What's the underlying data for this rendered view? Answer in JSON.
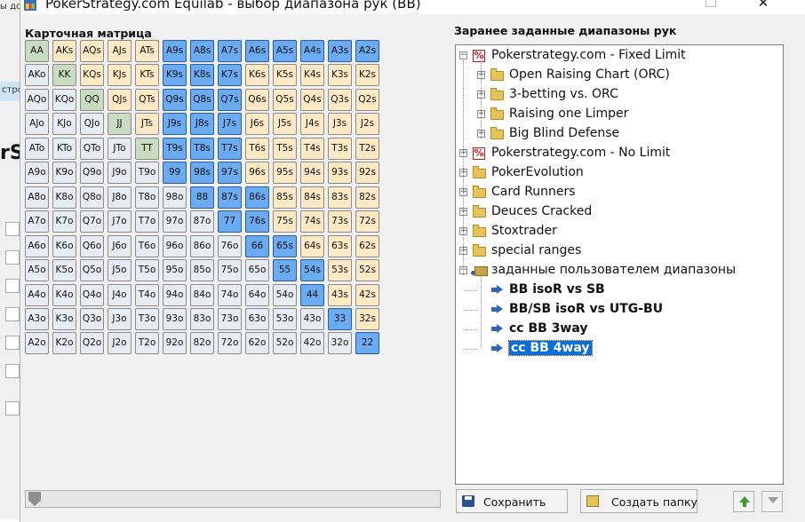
{
  "window": {
    "title": "PokerStrategy.com Equilab - выбор диапазона рук (BB)"
  },
  "background_app": {
    "label_top": "ы до",
    "label_mid": "стро",
    "label_big": "rS"
  },
  "matrix": {
    "label": "Карточная матрица",
    "rows": [
      [
        "AA",
        "AKs",
        "AQs",
        "AJs",
        "ATs",
        "A9s",
        "A8s",
        "A7s",
        "A6s",
        "A5s",
        "A4s",
        "A3s",
        "A2s"
      ],
      [
        "AKo",
        "KK",
        "KQs",
        "KJs",
        "KTs",
        "K9s",
        "K8s",
        "K7s",
        "K6s",
        "K5s",
        "K4s",
        "K3s",
        "K2s"
      ],
      [
        "AQo",
        "KQo",
        "QQ",
        "QJs",
        "QTs",
        "Q9s",
        "Q8s",
        "Q7s",
        "Q6s",
        "Q5s",
        "Q4s",
        "Q3s",
        "Q2s"
      ],
      [
        "AJo",
        "KJo",
        "QJo",
        "JJ",
        "JTs",
        "J9s",
        "J8s",
        "J7s",
        "J6s",
        "J5s",
        "J4s",
        "J3s",
        "J2s"
      ],
      [
        "ATo",
        "KTo",
        "QTo",
        "JTo",
        "TT",
        "T9s",
        "T8s",
        "T7s",
        "T6s",
        "T5s",
        "T4s",
        "T3s",
        "T2s"
      ],
      [
        "A9o",
        "K9o",
        "Q9o",
        "J9o",
        "T9o",
        "99",
        "98s",
        "97s",
        "96s",
        "95s",
        "94s",
        "93s",
        "92s"
      ],
      [
        "A8o",
        "K8o",
        "Q8o",
        "J8o",
        "T8o",
        "98o",
        "88",
        "87s",
        "86s",
        "85s",
        "84s",
        "83s",
        "82s"
      ],
      [
        "A7o",
        "K7o",
        "Q7o",
        "J7o",
        "T7o",
        "97o",
        "87o",
        "77",
        "76s",
        "75s",
        "74s",
        "73s",
        "72s"
      ],
      [
        "A6o",
        "K6o",
        "Q6o",
        "J6o",
        "T6o",
        "96o",
        "86o",
        "76o",
        "66",
        "65s",
        "64s",
        "63s",
        "62s"
      ],
      [
        "A5o",
        "K5o",
        "Q5o",
        "J5o",
        "T5o",
        "95o",
        "85o",
        "75o",
        "65o",
        "55",
        "54s",
        "53s",
        "52s"
      ],
      [
        "A4o",
        "K4o",
        "Q4o",
        "J4o",
        "T4o",
        "94o",
        "84o",
        "74o",
        "64o",
        "54o",
        "44",
        "43s",
        "42s"
      ],
      [
        "A3o",
        "K3o",
        "Q3o",
        "J3o",
        "T3o",
        "93o",
        "83o",
        "73o",
        "63o",
        "53o",
        "43o",
        "33",
        "32s"
      ],
      [
        "A2o",
        "K2o",
        "Q2o",
        "J2o",
        "T2o",
        "92o",
        "82o",
        "72o",
        "62o",
        "52o",
        "42o",
        "32o",
        "22"
      ]
    ],
    "selected": [
      "A9s",
      "A8s",
      "A7s",
      "A6s",
      "A5s",
      "A4s",
      "A3s",
      "A2s",
      "K9s",
      "K8s",
      "K7s",
      "Q9s",
      "Q8s",
      "Q7s",
      "J9s",
      "J8s",
      "J7s",
      "T9s",
      "T8s",
      "T7s",
      "99",
      "98s",
      "97s",
      "88",
      "87s",
      "86s",
      "77",
      "76s",
      "66",
      "65s",
      "55",
      "54s",
      "44",
      "33",
      "22"
    ],
    "colors": {
      "pair": "#c9dcbf",
      "suited": "#fde9c4",
      "offsuit": "#e7ecf2",
      "selected": "#6aabf2"
    },
    "slider_value": 0
  },
  "ranges": {
    "label": "Заранее заданные диапазоны рук",
    "items": [
      {
        "label": "Pokerstrategy.com - Fixed Limit",
        "level": 0,
        "icon": "pokerstrategy-icon",
        "expander": "−"
      },
      {
        "label": "Open Raising Chart (ORC)",
        "level": 1,
        "icon": "folder-icon",
        "expander": "+"
      },
      {
        "label": "3-betting vs. ORC",
        "level": 1,
        "icon": "folder-icon",
        "expander": "+"
      },
      {
        "label": "Raising one Limper",
        "level": 1,
        "icon": "folder-icon",
        "expander": "+"
      },
      {
        "label": "Big Blind Defense",
        "level": 1,
        "icon": "folder-icon",
        "expander": "+"
      },
      {
        "label": "Pokerstrategy.com - No Limit",
        "level": 0,
        "icon": "pokerstrategy-icon",
        "expander": "+"
      },
      {
        "label": "PokerEvolution",
        "level": 0,
        "icon": "folder-icon",
        "expander": "+"
      },
      {
        "label": "Card Runners",
        "level": 0,
        "icon": "folder-icon",
        "expander": "+"
      },
      {
        "label": "Deuces Cracked",
        "level": 0,
        "icon": "folder-icon",
        "expander": "+"
      },
      {
        "label": "Stoxtrader",
        "level": 0,
        "icon": "folder-icon",
        "expander": "+"
      },
      {
        "label": "special ranges",
        "level": 0,
        "icon": "folder-icon",
        "expander": "+"
      },
      {
        "label": "заданные пользователем диапазоны",
        "level": 0,
        "icon": "user-folder-icon",
        "expander": "−"
      },
      {
        "label": "BB isoR vs SB",
        "level": 1,
        "icon": "arrow-icon",
        "bold": true
      },
      {
        "label": "BB/SB isoR vs UTG-BU",
        "level": 1,
        "icon": "arrow-icon",
        "bold": true
      },
      {
        "label": "cc BB 3way",
        "level": 1,
        "icon": "arrow-icon",
        "bold": true
      },
      {
        "label": "cc BB 4way",
        "level": 1,
        "icon": "arrow-icon",
        "bold": true,
        "selected": true
      }
    ]
  },
  "buttons": {
    "save": "Сохранить",
    "new_folder": "Создать папку"
  }
}
